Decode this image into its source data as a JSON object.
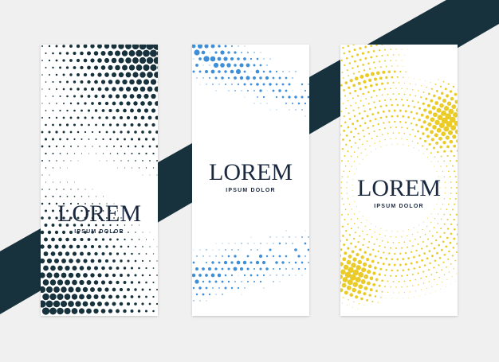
{
  "colors": {
    "background_light": "#f0f0f0",
    "background_band": "#17323c",
    "card": "#ffffff",
    "dots_dark": "#17323c",
    "dots_blue": "#3e8fd8",
    "dots_yellow": "#eacb28",
    "text": "#1a2840"
  },
  "banners": [
    {
      "title": "LOREM",
      "subtitle": "IPSUM DOLOR",
      "style": "dark-halftone"
    },
    {
      "title": "LOREM",
      "subtitle": "IPSUM DOLOR",
      "style": "blue-splatter-halftone"
    },
    {
      "title": "LOREM",
      "subtitle": "IPSUM DOLOR",
      "style": "yellow-circular-halftone"
    }
  ]
}
